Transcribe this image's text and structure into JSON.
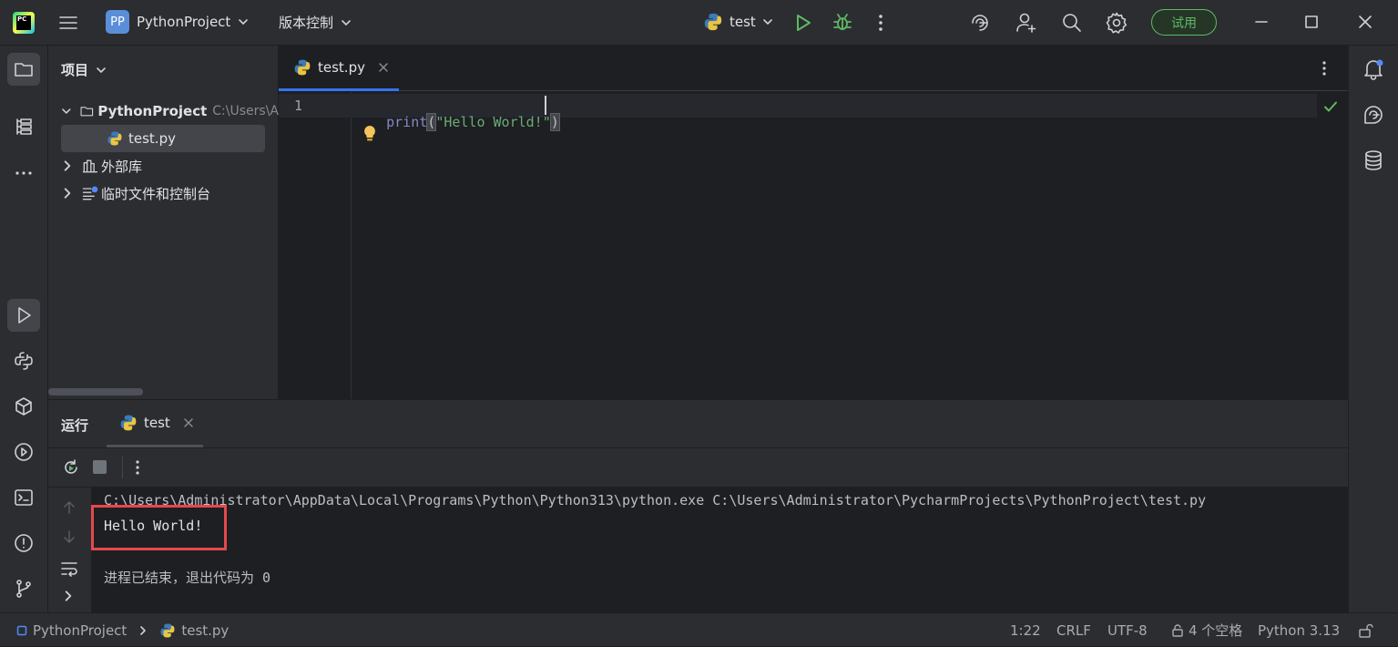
{
  "titlebar": {
    "app_logo": "PC",
    "project_initials": "PP",
    "project_name": "PythonProject",
    "vcs_label": "版本控制",
    "run_config": "test",
    "trial_label": "试用"
  },
  "project_panel": {
    "title": "项目",
    "root_name": "PythonProject",
    "root_path": "C:\\Users\\A",
    "file_name": "test.py",
    "external_libs": "外部库",
    "scratches": "临时文件和控制台"
  },
  "editor": {
    "tab_label": "test.py",
    "line_number": "1",
    "code_func": "print",
    "code_open": "(",
    "code_string": "\"Hello World!\"",
    "code_close": ")"
  },
  "run_panel": {
    "title": "运行",
    "tab_label": "test",
    "command_line": "C:\\Users\\Administrator\\AppData\\Local\\Programs\\Python\\Python313\\python.exe C:\\Users\\Administrator\\PycharmProjects\\PythonProject\\test.py",
    "output": "Hello World!",
    "exit_message": "进程已结束，退出代码为 0"
  },
  "statusbar": {
    "project": "PythonProject",
    "file": "test.py",
    "position": "1:22",
    "line_ending": "CRLF",
    "encoding": "UTF-8",
    "indent": "4 个空格",
    "interpreter": "Python 3.13"
  },
  "colors": {
    "accent": "#3574f0",
    "run_green": "#5fb865",
    "highlight_box": "#e5484d",
    "string_green": "#6aab73",
    "keyword_purple": "#8888c6"
  }
}
